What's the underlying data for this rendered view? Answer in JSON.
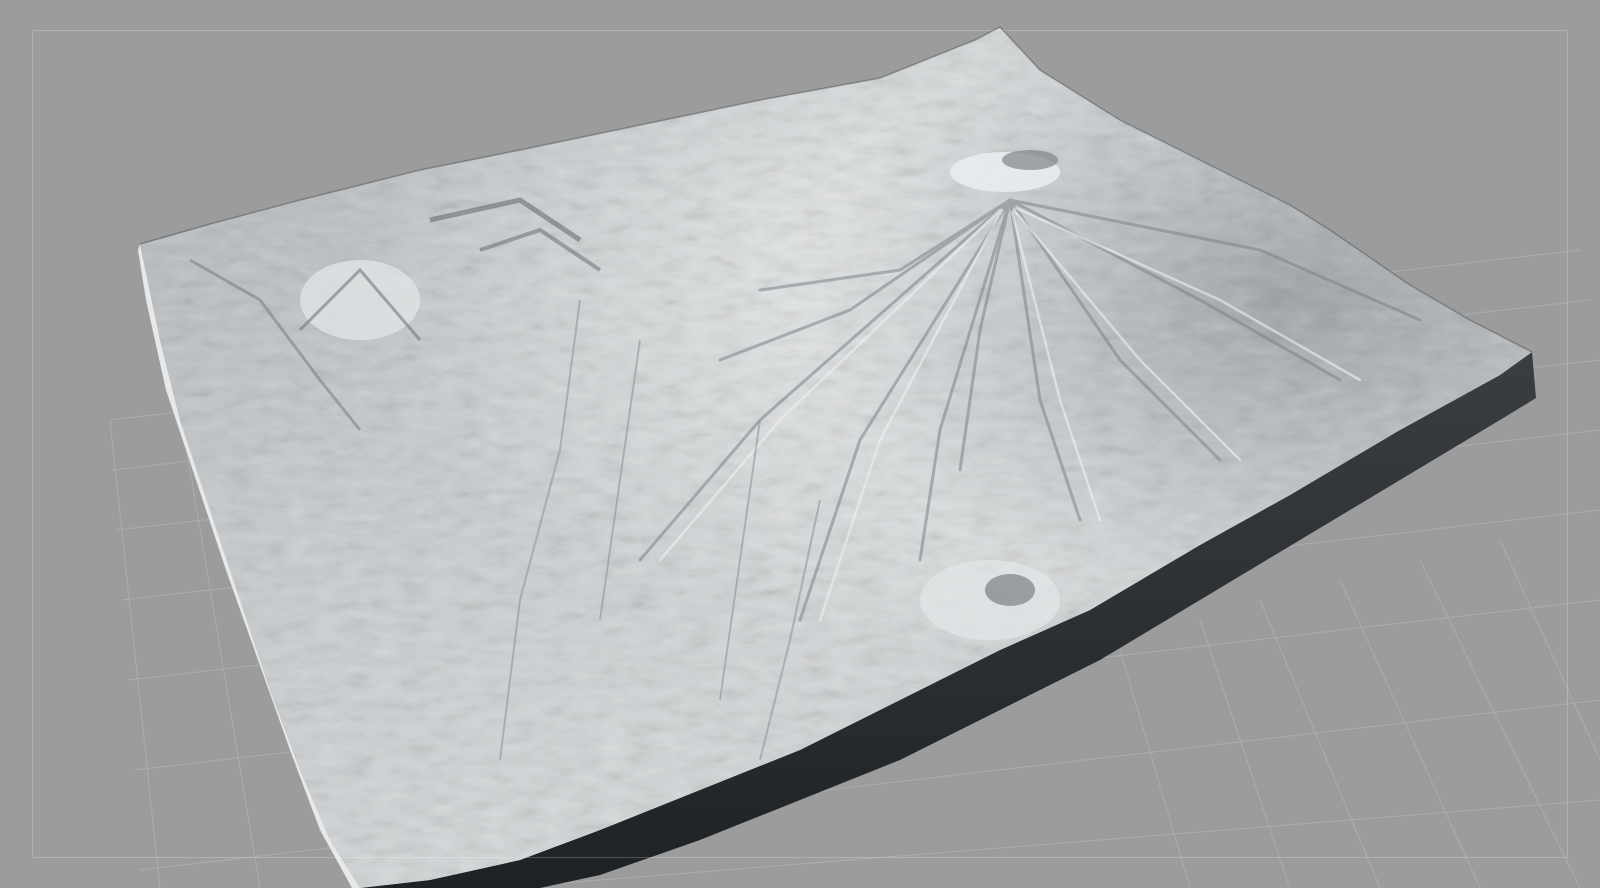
{
  "viewport": {
    "label": "",
    "colors": {
      "background": "#9c9c9c",
      "grid_line": "#b2b2b2",
      "terrain_light": "#d9dcdd",
      "terrain_mid": "#b7bbbe",
      "terrain_shadow": "#6f767c",
      "base_side": "#2e3134",
      "base_side_dark": "#1f2225"
    },
    "objects": [
      {
        "name": "terrain-heightmap-model",
        "kind": "3D terrain mesh"
      },
      {
        "name": "ground-grid",
        "kind": "reference grid"
      }
    ]
  }
}
